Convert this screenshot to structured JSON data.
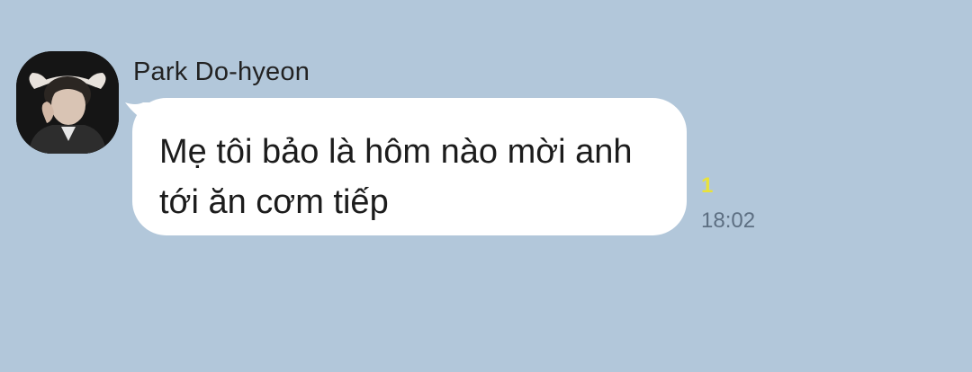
{
  "chat": {
    "message": {
      "sender": "Park Do-hyeon",
      "avatar_icon": "profile-photo",
      "text_line1": "Mẹ tôi bảo là hôm nào mời anh",
      "text_line2": "tới ăn cơm tiếp",
      "unread": "1",
      "time": "18:02"
    }
  },
  "colors": {
    "background": "#b2c7da",
    "bubble": "#ffffff",
    "unread": "#e9e23a",
    "timestamp": "#5d6f82"
  }
}
